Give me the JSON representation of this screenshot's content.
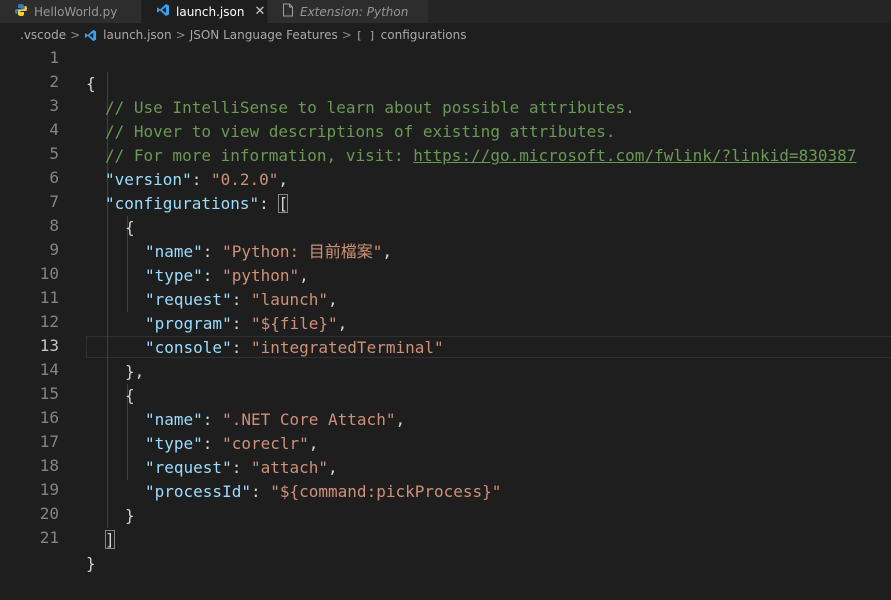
{
  "tabs": [
    {
      "label": "HelloWorld.py",
      "icon": "python-icon"
    },
    {
      "label": "launch.json",
      "icon": "vscode-icon",
      "close": "✕"
    },
    {
      "label": "Extension: Python",
      "icon": "file-icon"
    }
  ],
  "breadcrumb": {
    "folder": ".vscode",
    "file": "launch.json",
    "schema": "JSON Language Features",
    "node_icon": "[ ]",
    "node": "configurations",
    "sep": ">"
  },
  "editor": {
    "line_numbers": [
      "1",
      "2",
      "3",
      "4",
      "5",
      "6",
      "7",
      "8",
      "9",
      "10",
      "11",
      "12",
      "13",
      "14",
      "15",
      "16",
      "17",
      "18",
      "19",
      "20",
      "21"
    ],
    "current_line": "13",
    "text": {
      "open_brace": "{",
      "close_brace": "}",
      "comment1": "// Use IntelliSense to learn about possible attributes.",
      "comment2": "// Hover to view descriptions of existing attributes.",
      "comment3_prefix": "// For more information, visit: ",
      "comment3_url": "https://go.microsoft.com/fwlink/?linkid=830387",
      "key_version": "\"version\"",
      "val_version": "\"0.2.0\"",
      "key_configurations": "\"configurations\"",
      "open_bracket": "[",
      "close_bracket": "]",
      "obj_close_comma": "},",
      "key_name": "\"name\"",
      "key_type": "\"type\"",
      "key_request": "\"request\"",
      "key_program": "\"program\"",
      "key_console": "\"console\"",
      "key_processId": "\"processId\"",
      "val_name1": "\"Python: 目前檔案\"",
      "val_type1": "\"python\"",
      "val_request1": "\"launch\"",
      "val_program1": "\"${file}\"",
      "val_console1": "\"integratedTerminal\"",
      "val_name2": "\".NET Core Attach\"",
      "val_type2": "\"coreclr\"",
      "val_request2": "\"attach\"",
      "val_processId2": "\"${command:pickProcess}\"",
      "colon": ": ",
      "comma": ","
    }
  }
}
